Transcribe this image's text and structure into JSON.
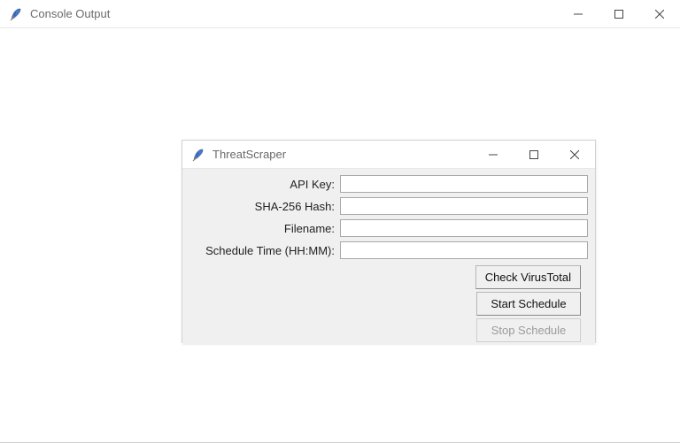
{
  "consoleWindow": {
    "title": "Console Output",
    "iconName": "feather-icon"
  },
  "threatWindow": {
    "title": "ThreatScraper",
    "iconName": "feather-icon",
    "fields": {
      "apiKey": {
        "label": "API Key:",
        "value": ""
      },
      "sha256": {
        "label": "SHA-256 Hash:",
        "value": ""
      },
      "filename": {
        "label": "Filename:",
        "value": ""
      },
      "schedule": {
        "label": "Schedule Time (HH:MM):",
        "value": ""
      }
    },
    "buttons": {
      "check": "Check VirusTotal",
      "start": "Start Schedule",
      "stop": "Stop Schedule"
    }
  },
  "winControls": {
    "minimize": "Minimize",
    "maximize": "Maximize",
    "close": "Close"
  }
}
